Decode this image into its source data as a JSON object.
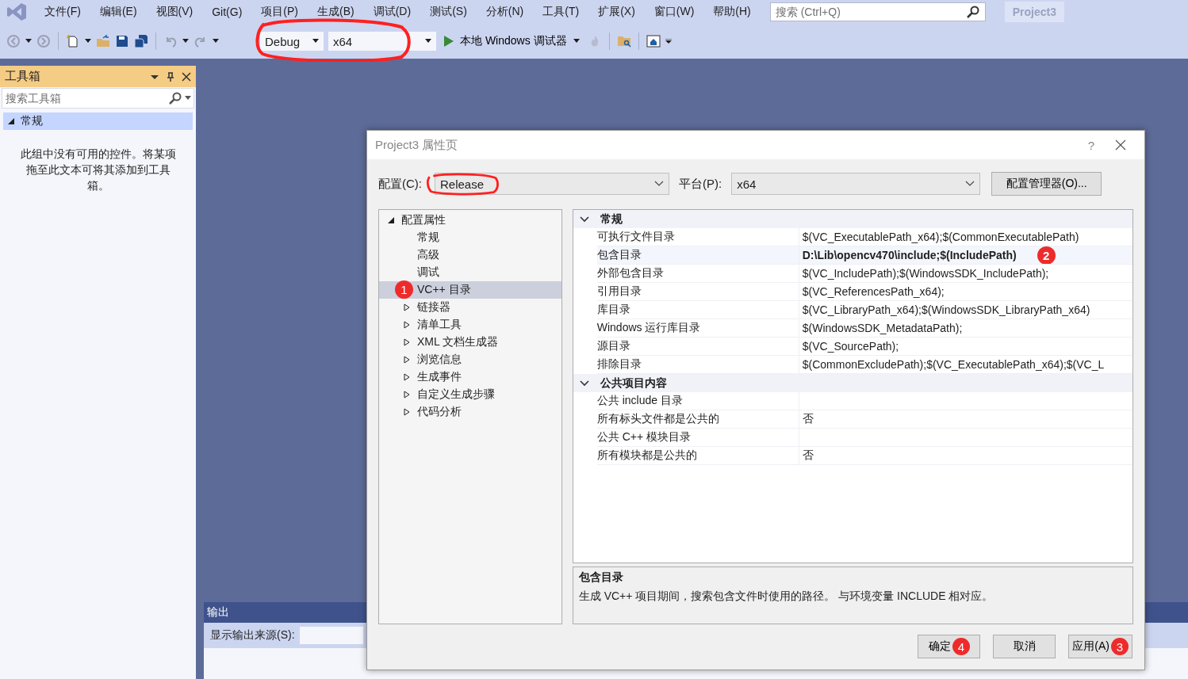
{
  "menu": {
    "items": [
      "文件(F)",
      "编辑(E)",
      "视图(V)",
      "Git(G)",
      "项目(P)",
      "生成(B)",
      "调试(D)",
      "测试(S)",
      "分析(N)",
      "工具(T)",
      "扩展(X)",
      "窗口(W)",
      "帮助(H)"
    ],
    "search": {
      "placeholder": "搜索 (Ctrl+Q)"
    },
    "project": "Project3"
  },
  "toolbar": {
    "configuration": "Debug",
    "platform": "x64",
    "debugger": "本地 Windows 调试器"
  },
  "toolbox": {
    "title": "工具箱",
    "search": {
      "placeholder": "搜索工具箱"
    },
    "group": {
      "label": "常规",
      "expanded": true
    },
    "message": "此组中没有可用的控件。将某项拖至此文本可将其添加到工具箱。"
  },
  "output": {
    "title": "输出",
    "source_label": "显示输出来源(S):"
  },
  "dialog": {
    "title": "Project3 属性页",
    "help": "?",
    "configuration_label": "配置(C):",
    "configuration": "Release",
    "platform_label": "平台(P):",
    "platform": "x64",
    "manager_button": "配置管理器(O)...",
    "tree": [
      {
        "label": "配置属性",
        "kind": "folder",
        "expanded": true,
        "selected": false,
        "children": [
          {
            "label": "常规",
            "kind": "leaf",
            "selected": false
          },
          {
            "label": "高级",
            "kind": "leaf",
            "selected": false
          },
          {
            "label": "调试",
            "kind": "leaf",
            "selected": false
          },
          {
            "label": "VC++ 目录",
            "kind": "leaf",
            "selected": true,
            "badge": "1"
          },
          {
            "label": "链接器",
            "kind": "folder",
            "expanded": false,
            "selected": false
          },
          {
            "label": "清单工具",
            "kind": "folder",
            "expanded": false,
            "selected": false
          },
          {
            "label": "XML 文档生成器",
            "kind": "folder",
            "expanded": false,
            "selected": false
          },
          {
            "label": "浏览信息",
            "kind": "folder",
            "expanded": false,
            "selected": false
          },
          {
            "label": "生成事件",
            "kind": "folder",
            "expanded": false,
            "selected": false
          },
          {
            "label": "自定义生成步骤",
            "kind": "folder",
            "expanded": false,
            "selected": false
          },
          {
            "label": "代码分析",
            "kind": "folder",
            "expanded": false,
            "selected": false
          }
        ]
      }
    ],
    "sections": [
      {
        "title": "常规",
        "expanded": true,
        "rows": [
          {
            "name": "可执行文件目录",
            "value": "$(VC_ExecutablePath_x64);$(CommonExecutablePath)",
            "selected": false,
            "bold": false
          },
          {
            "name": "包含目录",
            "value": "D:\\Lib\\opencv470\\include;$(IncludePath)",
            "selected": true,
            "bold": true,
            "badge": "2"
          },
          {
            "name": "外部包含目录",
            "value": "$(VC_IncludePath);$(WindowsSDK_IncludePath);",
            "selected": false,
            "bold": false
          },
          {
            "name": "引用目录",
            "value": "$(VC_ReferencesPath_x64);",
            "selected": false,
            "bold": false
          },
          {
            "name": "库目录",
            "value": "$(VC_LibraryPath_x64);$(WindowsSDK_LibraryPath_x64)",
            "selected": false,
            "bold": false
          },
          {
            "name": "Windows 运行库目录",
            "value": "$(WindowsSDK_MetadataPath);",
            "selected": false,
            "bold": false
          },
          {
            "name": "源目录",
            "value": "$(VC_SourcePath);",
            "selected": false,
            "bold": false
          },
          {
            "name": "排除目录",
            "value": "$(CommonExcludePath);$(VC_ExecutablePath_x64);$(VC_L",
            "selected": false,
            "bold": false
          }
        ]
      },
      {
        "title": "公共项目内容",
        "expanded": true,
        "rows": [
          {
            "name": "公共 include 目录",
            "selected": false
          },
          {
            "name": "所有标头文件都是公共的",
            "value": "否",
            "selected": false,
            "bold": false
          },
          {
            "name": "公共 C++ 模块目录",
            "selected": false
          },
          {
            "name": "所有模块都是公共的",
            "value": "否",
            "selected": false,
            "bold": false
          }
        ]
      }
    ],
    "description": {
      "title": "包含目录",
      "text": "生成 VC++ 项目期间，搜索包含文件时使用的路径。 与环境变量 INCLUDE 相对应。"
    },
    "buttons": [
      {
        "label": "确定",
        "badge": "4"
      },
      {
        "label": "取消"
      },
      {
        "label": "应用(A)",
        "badge": "3"
      }
    ]
  }
}
